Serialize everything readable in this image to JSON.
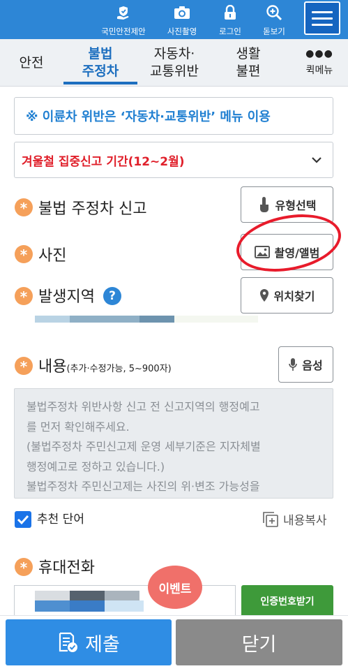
{
  "topbar": {
    "items": [
      {
        "label": "국민안전제안",
        "icon": "safety-proposal-icon"
      },
      {
        "label": "사진촬영",
        "icon": "camera-icon"
      },
      {
        "label": "로그인",
        "icon": "lock-icon"
      },
      {
        "label": "돋보기",
        "icon": "magnifier-plus-icon"
      }
    ],
    "menu_icon": "hamburger-icon"
  },
  "tabs": {
    "items": [
      {
        "line1": "안전",
        "line2": ""
      },
      {
        "line1": "불법",
        "line2": "주정차"
      },
      {
        "line1": "자동차·",
        "line2": "교통위반"
      },
      {
        "line1": "생활",
        "line2": "불편"
      }
    ],
    "active_index": 1,
    "quick": {
      "dots": "●●●",
      "label": "퀵메뉴"
    }
  },
  "form": {
    "notice": "※ 이륜차 위반은 ‘자동차·교통위반’ 메뉴 이용",
    "period_select": "겨울철 집중신고 기간(12~2월)",
    "fields": {
      "type": {
        "label": "불법 주정차 신고",
        "button": "유형선택"
      },
      "photo": {
        "label": "사진",
        "button": "촬영/앨범"
      },
      "location": {
        "label": "발생지역",
        "help": "?",
        "button": "위치찾기"
      },
      "content": {
        "label": "내용",
        "sub": "(추가·수정가능, 5~900자)",
        "button": "음성",
        "placeholder_lines": [
          "불법주정차 위반사항 신고 전 신고지역의 행정예고",
          "를 먼저 확인해주세요.",
          "(불법주정차 주민신고제 운영 세부기준은 지자체별",
          "행정예고로 정하고 있습니다.)",
          "불법주정차 주민신고제는 사진의 위·변조 가능성을"
        ]
      },
      "phone": {
        "label": "휴대전화",
        "button": "인증번호받기"
      }
    },
    "recommend_checkbox": {
      "label": "추천 단어",
      "checked": true
    },
    "copy_content": "내용복사"
  },
  "event_badge": "이벤트",
  "footer": {
    "submit": "제출",
    "close": "닫기"
  },
  "colors": {
    "primary": "#2d86d6",
    "alert": "#e0202b",
    "required": "#f5a05a",
    "verify": "#3e9a3a",
    "event": "#f0706a"
  }
}
